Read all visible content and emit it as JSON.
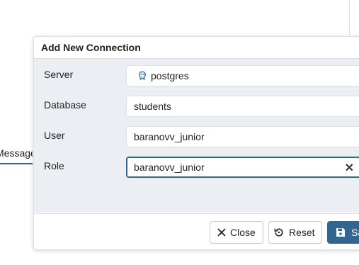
{
  "background": {
    "tab_label": "Messages"
  },
  "dialog": {
    "title": "Add New Connection",
    "fields": {
      "server": {
        "label": "Server",
        "value": "postgres",
        "icon": "postgres-elephant-icon"
      },
      "database": {
        "label": "Database",
        "value": "students"
      },
      "user": {
        "label": "User",
        "value": "baranovv_junior"
      },
      "role": {
        "label": "Role",
        "value": "baranovv_junior",
        "clear_glyph": "✕"
      }
    },
    "footer": {
      "close_label": "Close",
      "reset_label": "Reset",
      "save_label": "Save"
    }
  },
  "colors": {
    "primary": "#326690",
    "body_bg": "#ebeef3",
    "border": "#dde0e6"
  }
}
